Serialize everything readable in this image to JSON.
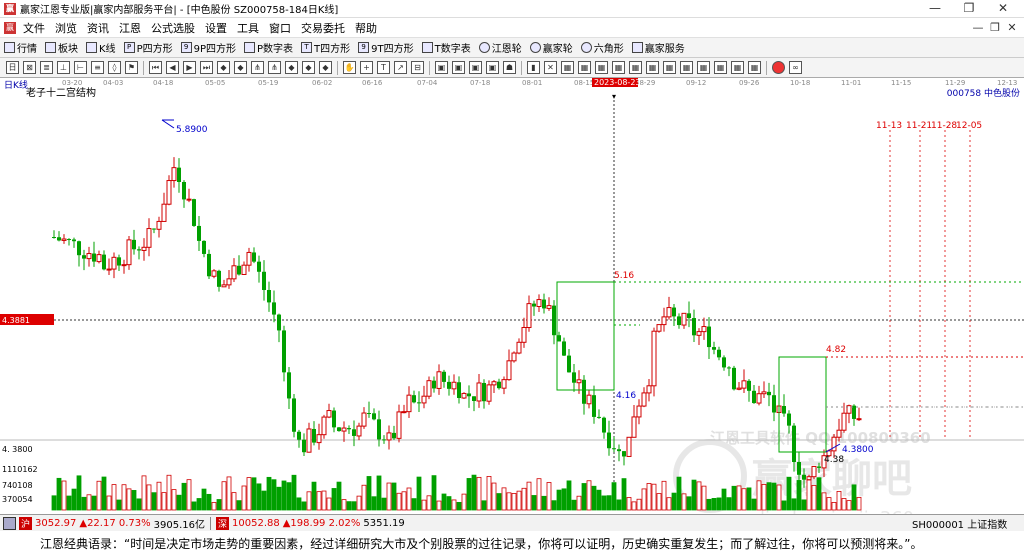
{
  "window": {
    "title": "赢家江恩专业版|赢家内部服务平台| - [中色股份  SZ000758-184日K线]",
    "controls": [
      "—",
      "❐",
      "✕"
    ]
  },
  "menu": [
    "文件",
    "浏览",
    "资讯",
    "江恩",
    "公式选股",
    "设置",
    "工具",
    "窗口",
    "交易委托",
    "帮助"
  ],
  "toolbar1": [
    {
      "label": "行情",
      "icon": "grid-icon"
    },
    {
      "label": "板块",
      "icon": "blocks-icon"
    },
    {
      "label": "K线",
      "icon": "candle-icon"
    },
    {
      "label": "P四方形",
      "icon": "square-icon"
    },
    {
      "label": "9P四方形",
      "icon": "square-icon"
    },
    {
      "label": "P数字表",
      "icon": "table-icon"
    },
    {
      "label": "T四方形",
      "icon": "square-icon"
    },
    {
      "label": "9T四方形",
      "icon": "square-icon"
    },
    {
      "label": "T数字表",
      "icon": "table-icon"
    },
    {
      "label": "江恩轮",
      "icon": "wheel-icon"
    },
    {
      "label": "赢家轮",
      "icon": "wheel-icon"
    },
    {
      "label": "六角形",
      "icon": "hexagon-icon"
    },
    {
      "label": "赢家服务",
      "icon": "service-icon"
    }
  ],
  "chart": {
    "period_label": "日K线",
    "indicator_label": "老子十二宫结构",
    "stock": "000758  中色股份",
    "cursor_price": "4.3881",
    "cursor_date": "2023-08-23",
    "volume_ticks": [
      "1110162",
      "740108",
      "370054"
    ],
    "price_tick": "4.3800",
    "price_tick_left": "4. 3800",
    "x_dates": [
      "03-20",
      "04-03",
      "04-18",
      "05-05",
      "05-19",
      "06-02",
      "06-16",
      "07-04",
      "07-18",
      "08-01",
      "08-15",
      "08-29",
      "09-12",
      "09-26",
      "10-18",
      "11-01",
      "11-15",
      "11-29",
      "12-13"
    ],
    "future_dates": [
      "11-13",
      "11-21",
      "11-28",
      "12-05"
    ],
    "annotations": {
      "high": "5.8900",
      "box1_top": "5.16",
      "box1_bottom": "4.16",
      "box2_top": "4.82",
      "low": "4.3800",
      "low_short": "4.38"
    },
    "watermark": {
      "line1": "江恩工具软件 QQ:100800360",
      "line2": "赢家聊吧",
      "line3": "liaoba.yingjia360"
    }
  },
  "status": [
    {
      "value": "3052.97",
      "change": "▲22.17 0.73%",
      "amount": "3905.16亿"
    },
    {
      "value": "10052.88",
      "change": "▲198.99 2.02%",
      "amount": "5351.19"
    }
  ],
  "status_index": "SH000001 上证指数",
  "quote": "江恩经典语录：“时间是决定市场走势的重要因素，经过详细研究大市及个别股票的过往记录，你将可以证明，历史确实重复发生；而了解过往，你将可以预测将来。”。",
  "colors": {
    "up": "#d00000",
    "down": "#00a000",
    "accent": "#0000cc",
    "cursor": "#d00000",
    "box": "#00aa00"
  }
}
